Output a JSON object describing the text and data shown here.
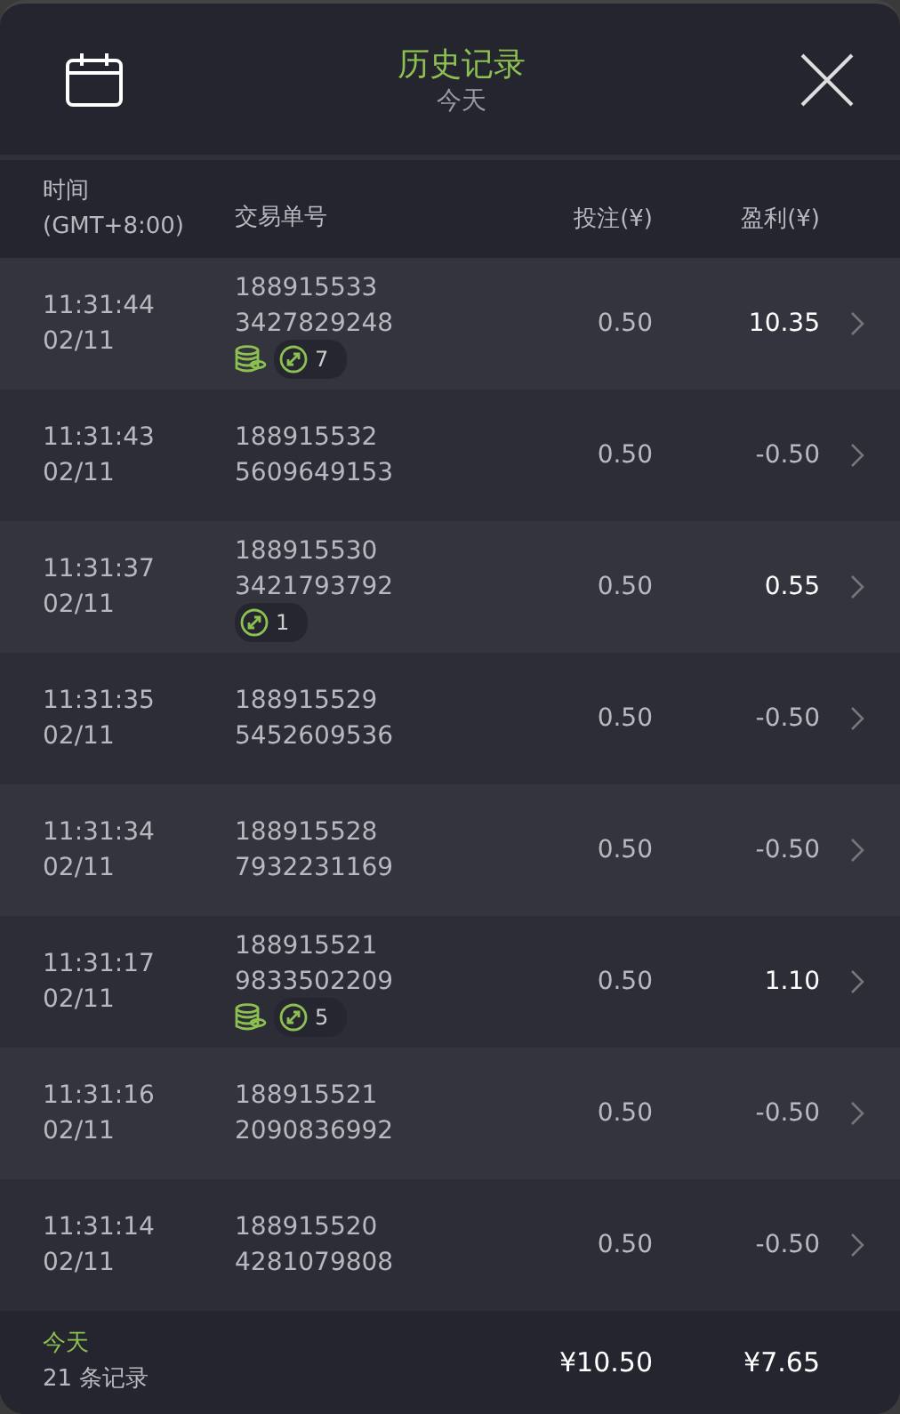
{
  "header": {
    "title": "历史记录",
    "subtitle": "今天"
  },
  "columns": {
    "time": "时间",
    "timezone": "(GMT+8:00)",
    "order": "交易单号",
    "stake": "投注(¥)",
    "profit": "盈利(¥)"
  },
  "rows": [
    {
      "time": "11:31:44",
      "date": "02/11",
      "order_a": "188915533",
      "order_b": "3427829248",
      "stake": "0.50",
      "profit": "10.35",
      "win": true,
      "coins": true,
      "count": "7"
    },
    {
      "time": "11:31:43",
      "date": "02/11",
      "order_a": "188915532",
      "order_b": "5609649153",
      "stake": "0.50",
      "profit": "-0.50",
      "win": false,
      "coins": false
    },
    {
      "time": "11:31:37",
      "date": "02/11",
      "order_a": "188915530",
      "order_b": "3421793792",
      "stake": "0.50",
      "profit": "0.55",
      "win": true,
      "coins": false,
      "count": "1"
    },
    {
      "time": "11:31:35",
      "date": "02/11",
      "order_a": "188915529",
      "order_b": "5452609536",
      "stake": "0.50",
      "profit": "-0.50",
      "win": false,
      "coins": false
    },
    {
      "time": "11:31:34",
      "date": "02/11",
      "order_a": "188915528",
      "order_b": "7932231169",
      "stake": "0.50",
      "profit": "-0.50",
      "win": false,
      "coins": false
    },
    {
      "time": "11:31:17",
      "date": "02/11",
      "order_a": "188915521",
      "order_b": "9833502209",
      "stake": "0.50",
      "profit": "1.10",
      "win": true,
      "coins": true,
      "count": "5"
    },
    {
      "time": "11:31:16",
      "date": "02/11",
      "order_a": "188915521",
      "order_b": "2090836992",
      "stake": "0.50",
      "profit": "-0.50",
      "win": false,
      "coins": false
    },
    {
      "time": "11:31:14",
      "date": "02/11",
      "order_a": "188915520",
      "order_b": "4281079808",
      "stake": "0.50",
      "profit": "-0.50",
      "win": false,
      "coins": false
    }
  ],
  "footer": {
    "period": "今天",
    "records": "21 条记录",
    "total_stake": "¥10.50",
    "total_profit": "¥7.65"
  }
}
